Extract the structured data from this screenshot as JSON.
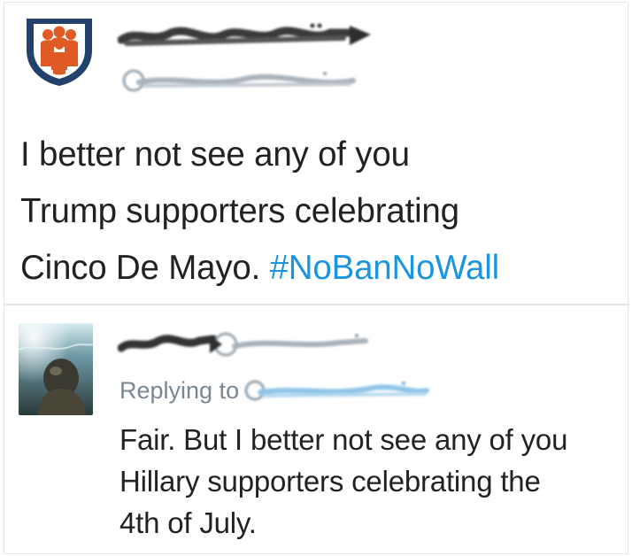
{
  "main_tweet": {
    "text_before_hashtag": "I better not see any of you\nTrump supporters celebrating\nCinco De Mayo. ",
    "hashtag": "#NoBanNoWall"
  },
  "reply_tweet": {
    "replying_label": "Replying to",
    "text": "Fair. But I better not see any of you\nHillary supporters celebrating the\n4th of July."
  },
  "colors": {
    "hashtag": "#1b95e0",
    "muted_text": "#7a8793",
    "divider": "#e1e8ed",
    "logo_orange": "#e05a23",
    "logo_navy": "#22426b"
  },
  "icons": {
    "main_avatar": "organization-logo-icon",
    "reply_avatar": "underwater-photo-avatar"
  }
}
